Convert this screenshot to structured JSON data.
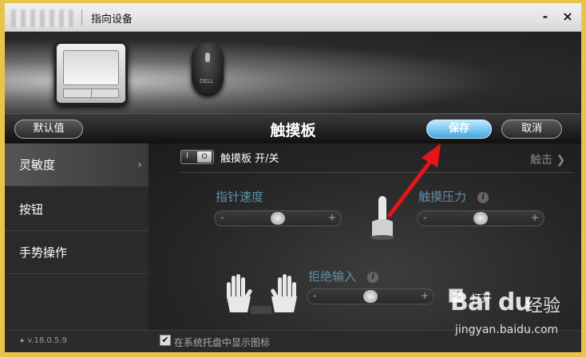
{
  "window": {
    "title": "指向设备",
    "minimize_label": "-",
    "close_label": "×"
  },
  "toolbar": {
    "default_label": "默认值",
    "page_title": "触摸板",
    "save_label": "保存",
    "cancel_label": "取消"
  },
  "sidebar": {
    "items": [
      {
        "label": "灵敏度",
        "active": true,
        "chevron": "›"
      },
      {
        "label": "按钮"
      },
      {
        "label": "手势操作"
      }
    ]
  },
  "content": {
    "toggle_off_mark": "I",
    "toggle_knob": "O",
    "toggle_label": "触摸板 开/关",
    "tap_label": "触击",
    "pointer_speed": {
      "label": "指针速度",
      "value": 0.5
    },
    "touch_pressure": {
      "label": "触摸压力",
      "info": "i",
      "value": 0.5
    },
    "palm_rejection": {
      "label": "拒绝输入",
      "info": "i",
      "value": 0.5,
      "enable_label": "打开",
      "enabled": true
    },
    "slider_minus": "-",
    "slider_plus": "+"
  },
  "status": {
    "version": "v.18.0.5.9",
    "tray_label": "在系统托盘中显示图标",
    "tray_checked": true,
    "check_mark": "✔"
  },
  "watermark": {
    "brand": "Bai du",
    "cn": "经验",
    "url": "jingyan.baidu.com"
  },
  "colors": {
    "accent": "#41a8e0",
    "arrow": "#e8141b"
  }
}
